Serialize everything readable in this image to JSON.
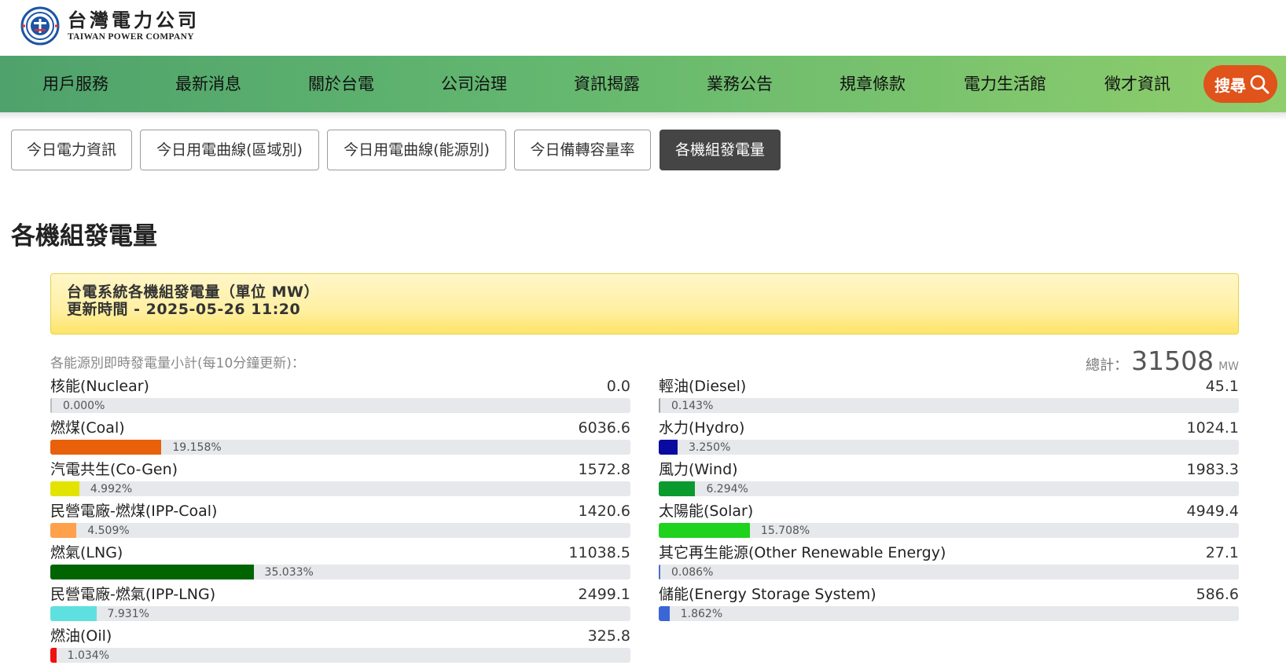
{
  "header": {
    "logo_cn": "台灣電力公司",
    "logo_en": "TAIWAN POWER COMPANY"
  },
  "nav": {
    "items": [
      "用戶服務",
      "最新消息",
      "關於台電",
      "公司治理",
      "資訊揭露",
      "業務公告",
      "規章條款",
      "電力生活館",
      "徵才資訊"
    ],
    "search_label": "搜尋"
  },
  "tabs": [
    {
      "label": "今日電力資訊",
      "active": false
    },
    {
      "label": "今日用電曲線(區域別)",
      "active": false
    },
    {
      "label": "今日用電曲線(能源別)",
      "active": false
    },
    {
      "label": "今日備轉容量率",
      "active": false
    },
    {
      "label": "各機組發電量",
      "active": true
    }
  ],
  "page_title": "各機組發電量",
  "panel": {
    "line1": "台電系統各機組發電量（單位 MW）",
    "line2": "更新時間 - 2025-05-26 11:20"
  },
  "summary": {
    "subtotal_label": "各能源別即時發電量小計(每10分鐘更新)：",
    "total_label": "總計：",
    "total_value": "31508",
    "total_unit": "MW"
  },
  "sources_left": [
    {
      "name": "核能(Nuclear)",
      "value": "0.0",
      "percent": "0.000%",
      "fraction": 0.0,
      "color": "#bdbdbd"
    },
    {
      "name": "燃煤(Coal)",
      "value": "6036.6",
      "percent": "19.158%",
      "fraction": 0.19158,
      "color": "#e8600a"
    },
    {
      "name": "汽電共生(Co-Gen)",
      "value": "1572.8",
      "percent": "4.992%",
      "fraction": 0.04992,
      "color": "#e3e300"
    },
    {
      "name": "民營電廠-燃煤(IPP-Coal)",
      "value": "1420.6",
      "percent": "4.509%",
      "fraction": 0.04509,
      "color": "#ffa04d"
    },
    {
      "name": "燃氣(LNG)",
      "value": "11038.5",
      "percent": "35.033%",
      "fraction": 0.35033,
      "color": "#006400"
    },
    {
      "name": "民營電廠-燃氣(IPP-LNG)",
      "value": "2499.1",
      "percent": "7.931%",
      "fraction": 0.07931,
      "color": "#5fe0e0"
    },
    {
      "name": "燃油(Oil)",
      "value": "325.8",
      "percent": "1.034%",
      "fraction": 0.01034,
      "color": "#ee1111"
    }
  ],
  "sources_right": [
    {
      "name": "輕油(Diesel)",
      "value": "45.1",
      "percent": "0.143%",
      "fraction": 0.00143,
      "color": "#a0a0a0"
    },
    {
      "name": "水力(Hydro)",
      "value": "1024.1",
      "percent": "3.250%",
      "fraction": 0.0325,
      "color": "#0a0aa0"
    },
    {
      "name": "風力(Wind)",
      "value": "1983.3",
      "percent": "6.294%",
      "fraction": 0.06294,
      "color": "#0a9a2e"
    },
    {
      "name": "太陽能(Solar)",
      "value": "4949.4",
      "percent": "15.708%",
      "fraction": 0.15708,
      "color": "#1ed21e"
    },
    {
      "name": "其它再生能源(Other Renewable Energy)",
      "value": "27.1",
      "percent": "0.086%",
      "fraction": 0.00086,
      "color": "#4a6fd1"
    },
    {
      "name": "儲能(Energy Storage System)",
      "value": "586.6",
      "percent": "1.862%",
      "fraction": 0.01862,
      "color": "#3a66d6"
    }
  ]
}
